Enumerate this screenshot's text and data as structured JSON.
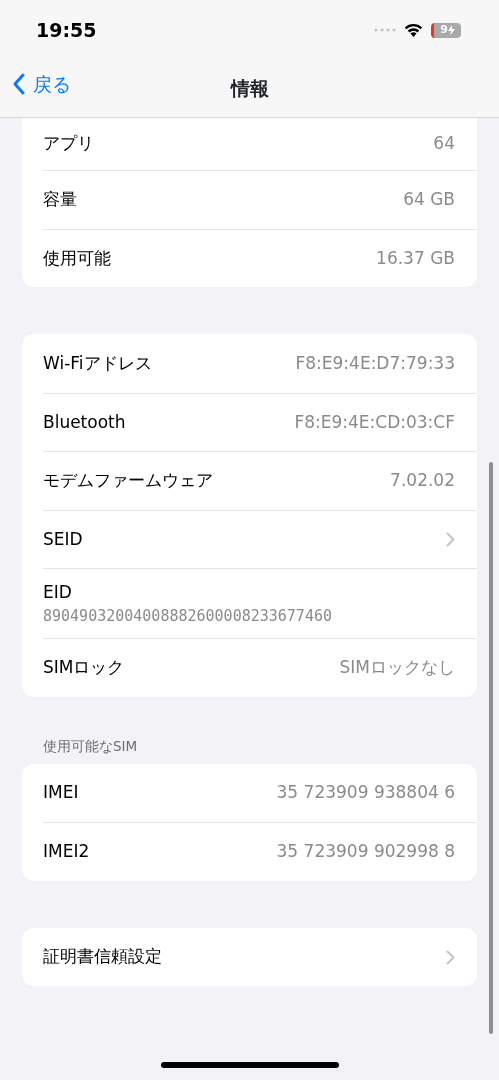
{
  "status_bar": {
    "time": "19:55",
    "battery": "9"
  },
  "nav": {
    "back": "戻る",
    "title": "情報"
  },
  "sections": [
    {
      "rows": [
        {
          "kind": "value",
          "label": "アプリ",
          "value": "64"
        },
        {
          "kind": "value",
          "label": "容量",
          "value": "64 GB"
        },
        {
          "kind": "value",
          "label": "使用可能",
          "value": "16.37 GB"
        }
      ]
    },
    {
      "rows": [
        {
          "kind": "value",
          "label": "Wi-Fiアドレス",
          "value": "F8:E9:4E:D7:79:33"
        },
        {
          "kind": "value",
          "label": "Bluetooth",
          "value": "F8:E9:4E:CD:03:CF"
        },
        {
          "kind": "value",
          "label": "モデムファームウェア",
          "value": "7.02.02"
        },
        {
          "kind": "chevron",
          "label": "SEID"
        },
        {
          "kind": "stacked",
          "label": "EID",
          "value": "89049032004008882600008233677460"
        },
        {
          "kind": "value",
          "label": "SIMロック",
          "value": "SIMロックなし"
        }
      ]
    },
    {
      "header": "使用可能なSIM",
      "rows": [
        {
          "kind": "value",
          "label": "IMEI",
          "value": "35 723909 938804 6"
        },
        {
          "kind": "value",
          "label": "IMEI2",
          "value": "35 723909 902998 8"
        }
      ]
    },
    {
      "rows": [
        {
          "kind": "chevron",
          "label": "証明書信頼設定"
        }
      ]
    }
  ]
}
